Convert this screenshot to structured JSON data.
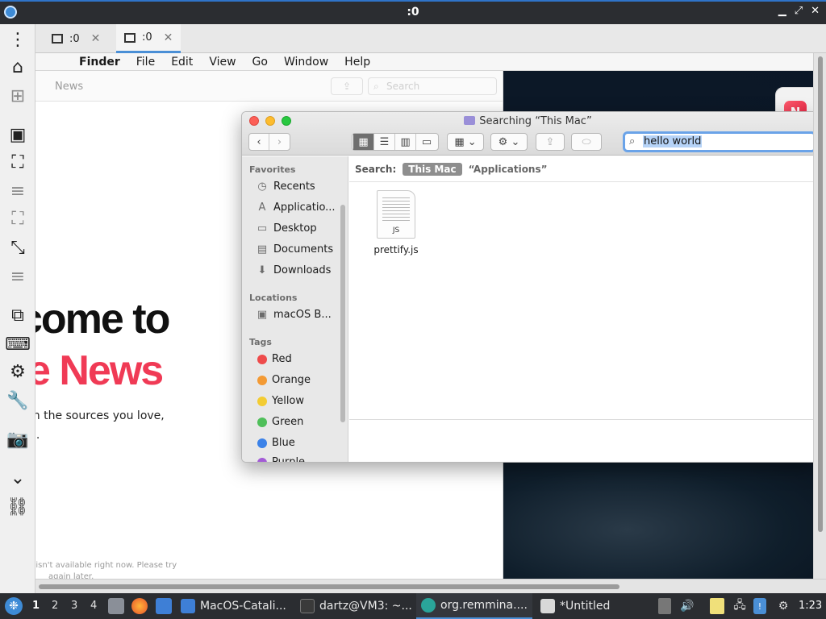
{
  "window": {
    "title": ":0",
    "controls": [
      "▁",
      "⤢",
      "✕"
    ]
  },
  "tabs": [
    {
      "label": ":0",
      "active": false
    },
    {
      "label": ":0",
      "active": true
    }
  ],
  "mac_menu": {
    "app": "Finder",
    "items": [
      "File",
      "Edit",
      "View",
      "Go",
      "Window",
      "Help"
    ]
  },
  "news": {
    "toolbar_label": "News",
    "search_placeholder": "Search",
    "headline_1": "come to",
    "headline_2": "e News",
    "subtitle_1": "m the sources you love,",
    "subtitle_2": "u.",
    "footer_1": "s isn't available right now. Please try",
    "footer_2": "again later."
  },
  "finder": {
    "title": "Searching “This Mac”",
    "search_value": "hello world",
    "scope_label": "Search:",
    "scope_active": "This Mac",
    "scope_other": "“Applications”",
    "sidebar": {
      "favorites_header": "Favorites",
      "favorites": [
        {
          "label": "Recents",
          "icon": "clock-icon"
        },
        {
          "label": "Applicatio...",
          "icon": "applications-icon"
        },
        {
          "label": "Desktop",
          "icon": "desktop-icon"
        },
        {
          "label": "Documents",
          "icon": "document-icon"
        },
        {
          "label": "Downloads",
          "icon": "download-icon"
        }
      ],
      "locations_header": "Locations",
      "locations": [
        {
          "label": "macOS B...",
          "icon": "disk-icon"
        }
      ],
      "tags_header": "Tags",
      "tags": [
        {
          "label": "Red",
          "color": "#ee4b4b"
        },
        {
          "label": "Orange",
          "color": "#f39a34"
        },
        {
          "label": "Yellow",
          "color": "#f3cc33"
        },
        {
          "label": "Green",
          "color": "#4fbf5a"
        },
        {
          "label": "Blue",
          "color": "#3b82e8"
        },
        {
          "label": "Purple",
          "color": "#a35bd6"
        }
      ]
    },
    "file": {
      "name": "prettify.js",
      "ext": "JS"
    }
  },
  "taskbar": {
    "workspaces": [
      "1",
      "2",
      "3",
      "4"
    ],
    "tasks": [
      {
        "label": "MacOS-Catali...",
        "icon_color": "#3e7fd6",
        "active": false
      },
      {
        "label": "dartz@VM3: ~...",
        "icon_color": "#3a3a3a",
        "active": false
      },
      {
        "label": "org.remmina....",
        "icon_color": "#2aa59a",
        "active": true
      },
      {
        "label": "*Untitled",
        "icon_color": "#d8d8d8",
        "active": false
      }
    ],
    "clock": "1:23"
  },
  "colors": {
    "accent": "#4a8fd6",
    "news_red": "#f03a55",
    "taskbar": "#2b2d31"
  }
}
